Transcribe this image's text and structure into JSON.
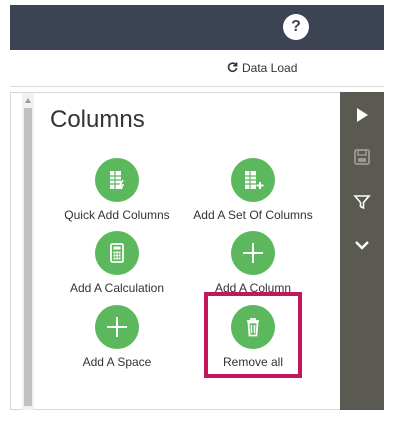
{
  "header": {
    "help_label": "?"
  },
  "subheader": {
    "data_load_label": "Data Load"
  },
  "panel": {
    "title": "Columns",
    "actions": [
      {
        "label": "Quick Add Columns",
        "icon": "quick-add-columns-icon"
      },
      {
        "label": "Add A Set Of Columns",
        "icon": "add-column-set-icon"
      },
      {
        "label": "Add A Calculation",
        "icon": "calculator-icon"
      },
      {
        "label": "Add A Column",
        "icon": "plus-icon"
      },
      {
        "label": "Add A Space",
        "icon": "plus-icon"
      },
      {
        "label": "Remove all",
        "icon": "trash-icon"
      }
    ]
  },
  "toolbar": {
    "items": [
      "play-icon",
      "save-icon",
      "filter-icon",
      "chevron-down-icon"
    ]
  },
  "colors": {
    "header_bg": "#3c4353",
    "action_green": "#5cb85c",
    "toolbar_bg": "#5a5a52",
    "highlight_border": "#c2185b"
  }
}
